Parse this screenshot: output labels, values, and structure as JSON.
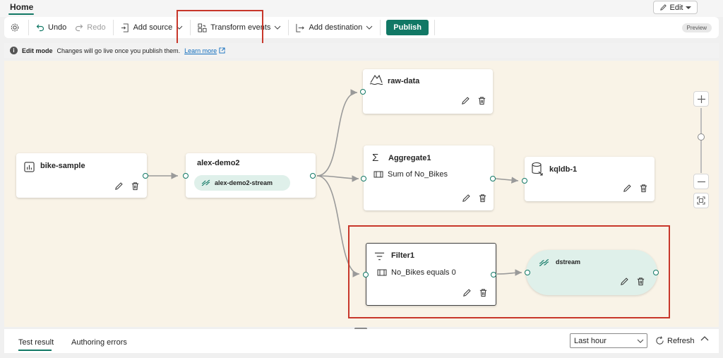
{
  "header": {
    "home_tab": "Home",
    "edit_label": "Edit"
  },
  "toolbar": {
    "undo": "Undo",
    "redo": "Redo",
    "add_source": "Add source",
    "transform_events": "Transform events",
    "add_destination": "Add destination",
    "publish": "Publish",
    "preview": "Preview"
  },
  "infobar": {
    "mode": "Edit mode",
    "message": "Changes will go live once you publish them.",
    "link": "Learn more"
  },
  "nodes": {
    "bike_sample": {
      "title": "bike-sample"
    },
    "alex_demo2": {
      "title": "alex-demo2",
      "stream": "alex-demo2-stream"
    },
    "raw_data": {
      "title": "raw-data"
    },
    "aggregate1": {
      "title": "Aggregate1",
      "detail": "Sum of No_Bikes"
    },
    "kqldb1": {
      "title": "kqldb-1"
    },
    "filter1": {
      "title": "Filter1",
      "detail": "No_Bikes equals 0"
    },
    "dstream": {
      "title": "dstream"
    }
  },
  "bottom": {
    "tabs": [
      "Test result",
      "Authoring errors"
    ],
    "time_range": "Last hour",
    "refresh": "Refresh"
  },
  "colors": {
    "accent": "#117865",
    "highlight": "#c8372b",
    "canvas": "#f9f3e7",
    "stream_pill": "#dff0ea"
  },
  "icons": [
    "gear-icon",
    "undo-icon",
    "redo-icon",
    "add-source-icon",
    "transform-icon",
    "destination-icon",
    "info-icon",
    "external-link-icon",
    "chart-icon",
    "stream-icon",
    "lakehouse-icon",
    "sigma-icon",
    "kql-database-icon",
    "filter-icon",
    "pencil-icon",
    "trash-icon",
    "zoom-in-icon",
    "zoom-out-icon",
    "fit-view-icon",
    "refresh-icon",
    "chevron-up-icon"
  ]
}
